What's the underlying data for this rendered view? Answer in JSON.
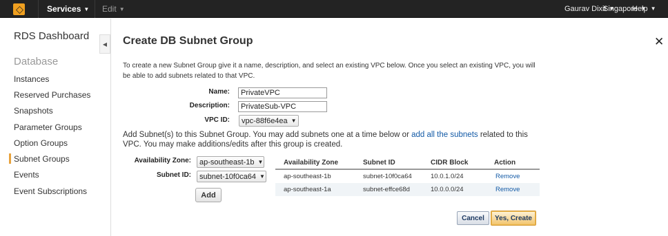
{
  "topbar": {
    "services_label": "Services",
    "edit_label": "Edit",
    "user_label": "Gaurav Dixit",
    "region_label": "Singapore",
    "help_label": "Help",
    "logo_icon": "aws-cube-icon",
    "accent_color": "#f0a020"
  },
  "sidebar": {
    "title": "RDS Dashboard",
    "section": "Database",
    "items": [
      {
        "label": "Instances"
      },
      {
        "label": "Reserved Purchases"
      },
      {
        "label": "Snapshots"
      },
      {
        "label": "Parameter Groups"
      },
      {
        "label": "Option Groups"
      },
      {
        "label": "Subnet Groups",
        "active": true
      },
      {
        "label": "Events"
      },
      {
        "label": "Event Subscriptions"
      }
    ],
    "active_color": "#e8a33d"
  },
  "dialog": {
    "title": "Create DB Subnet Group",
    "intro": "To create a new Subnet Group give it a name, description, and select an existing VPC below. Once you select an existing VPC, you will be able to add subnets related to that VPC.",
    "fields": {
      "name_label": "Name:",
      "name_value": "PrivateVPC",
      "description_label": "Description:",
      "description_value": "PrivateSub-VPC",
      "vpc_label": "VPC ID:",
      "vpc_value": "vpc-88f6e4ea"
    },
    "add_text_before": "Add Subnet(s) to this Subnet Group. You may add subnets one at a time below or ",
    "add_text_link": "add all the subnets",
    "add_text_after": " related to this VPC. You may make additions/edits after this group is created.",
    "az_label": "Availability Zone:",
    "az_value": "ap-southeast-1b",
    "subnet_label": "Subnet ID:",
    "subnet_value": "subnet-10f0ca64",
    "add_button": "Add",
    "table": {
      "headers": [
        "Availability Zone",
        "Subnet ID",
        "CIDR Block",
        "Action"
      ],
      "rows": [
        {
          "az": "ap-southeast-1b",
          "subnet": "subnet-10f0ca64",
          "cidr": "10.0.1.0/24",
          "action": "Remove"
        },
        {
          "az": "ap-southeast-1a",
          "subnet": "subnet-effce68d",
          "cidr": "10.0.0.0/24",
          "action": "Remove"
        }
      ]
    },
    "cancel_button": "Cancel",
    "create_button": "Yes, Create",
    "link_color": "#135aa6"
  }
}
